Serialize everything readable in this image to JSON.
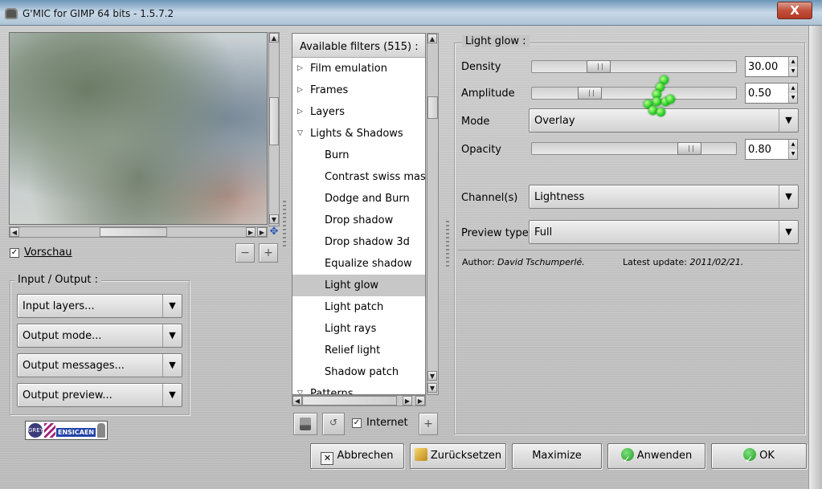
{
  "window": {
    "title": "G'MIC for GIMP 64 bits - 1.5.7.2",
    "close_label": "X"
  },
  "preview": {
    "checkbox_checked": true,
    "checkbox_label": "Vorschau",
    "zoom_out_label": "−",
    "zoom_in_label": "+"
  },
  "io": {
    "title": "Input / Output :",
    "combos": [
      "Input layers...",
      "Output mode...",
      "Output messages...",
      "Output preview..."
    ]
  },
  "filters": {
    "header": "Available filters (515) :",
    "items": [
      {
        "label": "Film emulation",
        "kind": "category",
        "expanded": false
      },
      {
        "label": "Frames",
        "kind": "category",
        "expanded": false
      },
      {
        "label": "Layers",
        "kind": "category",
        "expanded": false
      },
      {
        "label": "Lights & Shadows",
        "kind": "category",
        "expanded": true
      },
      {
        "label": "Burn",
        "kind": "filter"
      },
      {
        "label": "Contrast swiss mask",
        "kind": "filter"
      },
      {
        "label": "Dodge and Burn",
        "kind": "filter"
      },
      {
        "label": "Drop shadow",
        "kind": "filter"
      },
      {
        "label": "Drop shadow 3d",
        "kind": "filter"
      },
      {
        "label": "Equalize shadow",
        "kind": "filter"
      },
      {
        "label": "Light glow",
        "kind": "filter",
        "selected": true
      },
      {
        "label": "Light patch",
        "kind": "filter"
      },
      {
        "label": "Light rays",
        "kind": "filter"
      },
      {
        "label": "Relief light",
        "kind": "filter"
      },
      {
        "label": "Shadow patch",
        "kind": "filter"
      },
      {
        "label": "Patterns",
        "kind": "category",
        "expanded": true
      }
    ],
    "internet_label": "Internet",
    "internet_checked": true,
    "add_label": "+"
  },
  "params": {
    "title": "Light glow :",
    "density": {
      "label": "Density",
      "value": "30.00",
      "fraction": 0.3
    },
    "amplitude": {
      "label": "Amplitude",
      "value": "0.50",
      "fraction": 0.25
    },
    "mode": {
      "label": "Mode",
      "value": "Overlay"
    },
    "opacity": {
      "label": "Opacity",
      "value": "0.80",
      "fraction": 0.8
    },
    "channels": {
      "label": "Channel(s)",
      "value": "Lightness"
    },
    "preview_type": {
      "label": "Preview type",
      "value": "Full"
    },
    "author_prefix": "Author:",
    "author_name": "David Tschumperlé.",
    "update_prefix": "Latest update:",
    "update_date": "2011/02/21."
  },
  "buttons": {
    "cancel": "Abbrechen",
    "reset": "Zurücksetzen",
    "maximize": "Maximize",
    "apply": "Anwenden",
    "ok": "OK"
  },
  "logo": {
    "text": "ENSICAEN",
    "badge": "GREYC"
  },
  "colors": {
    "titlebar": "#aec4d6",
    "selection": "#c7c7c7",
    "cursor_green": "#2fd32a"
  }
}
